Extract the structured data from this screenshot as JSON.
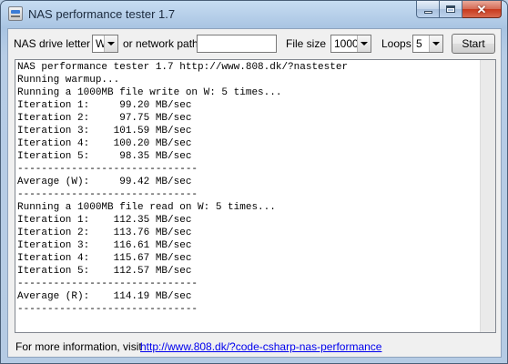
{
  "window": {
    "title": "NAS performance tester 1.7"
  },
  "toolbar": {
    "drive_label": "NAS drive letter",
    "drive_value": "W",
    "network_label": "or network path",
    "network_value": "",
    "filesize_label": "File size",
    "filesize_value": "1000",
    "loops_label": "Loops",
    "loops_value": "5",
    "start_label": "Start"
  },
  "output": {
    "text": "NAS performance tester 1.7 http://www.808.dk/?nastester\nRunning warmup...\nRunning a 1000MB file write on W: 5 times...\nIteration 1:     99.20 MB/sec\nIteration 2:     97.75 MB/sec\nIteration 3:    101.59 MB/sec\nIteration 4:    100.20 MB/sec\nIteration 5:     98.35 MB/sec\n------------------------------\nAverage (W):     99.42 MB/sec\n------------------------------\nRunning a 1000MB file read on W: 5 times...\nIteration 1:    112.35 MB/sec\nIteration 2:    113.76 MB/sec\nIteration 3:    116.61 MB/sec\nIteration 4:    115.67 MB/sec\nIteration 5:    112.57 MB/sec\n------------------------------\nAverage (R):    114.19 MB/sec\n------------------------------"
  },
  "footer": {
    "lead": "For more information, visit",
    "link": "http://www.808.dk/?code-csharp-nas-performance"
  }
}
